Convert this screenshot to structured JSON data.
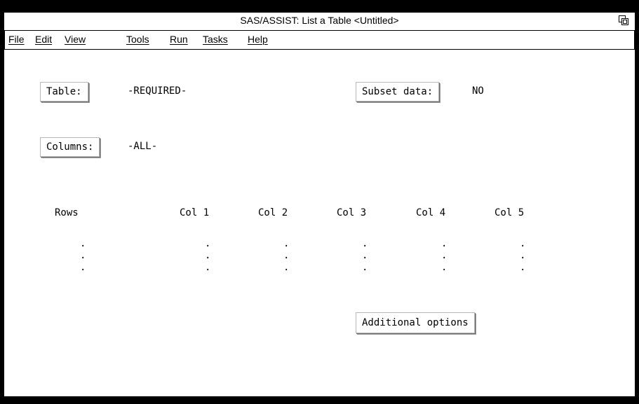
{
  "window": {
    "title": "SAS/ASSIST: List a Table <Untitled>"
  },
  "menu": [
    "File",
    "Edit",
    "View",
    "Tools",
    "Run",
    "Tasks",
    "Help"
  ],
  "form": {
    "table_button": "Table:",
    "table_value": "-REQUIRED-",
    "subset_button": "Subset data:",
    "subset_value": "NO",
    "columns_button": "Columns:",
    "columns_value": "-ALL-",
    "additional_button": "Additional options"
  },
  "preview": {
    "rows_label": "Rows",
    "columns": [
      "Col 1",
      "Col 2",
      "Col 3",
      "Col 4",
      "Col 5"
    ],
    "placeholder": "."
  },
  "icons": {
    "restore": "restore-window-icon"
  }
}
